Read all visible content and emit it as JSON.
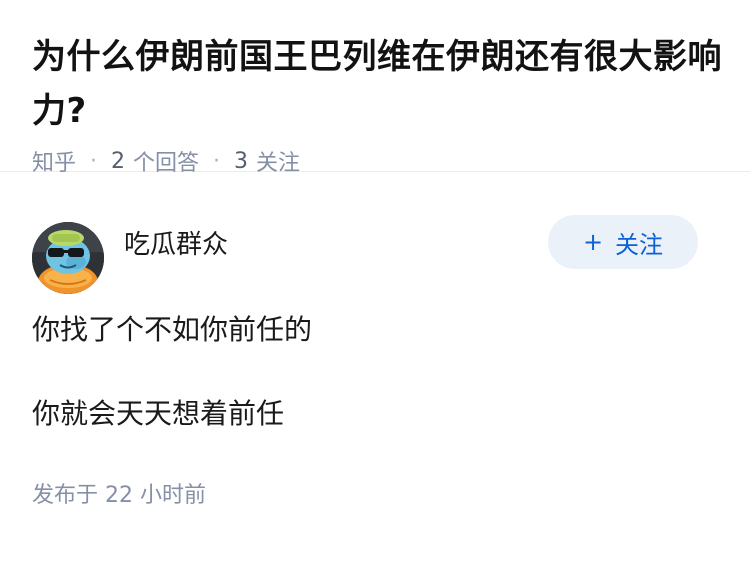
{
  "question": {
    "title": "为什么伊朗前国王巴列维在伊朗还有很大影响力?",
    "source": "知乎",
    "answer_count": "2",
    "answer_label": "个回答",
    "follow_count": "3",
    "follow_label": "关注"
  },
  "answer": {
    "author_name": "吃瓜群众",
    "avatar_icon": "cartoon-turtle-avatar",
    "follow_button": {
      "icon": "plus-icon",
      "icon_glyph": "+",
      "label": "关注"
    },
    "paragraphs": [
      "你找了个不如你前任的",
      "你就会天天想着前任"
    ],
    "publish_prefix": "发布于",
    "publish_number": "22",
    "publish_suffix": "小时前"
  },
  "colors": {
    "meta_gray": "#8590a6",
    "follow_blue": "#0b62d6",
    "follow_bg": "#ebf1f8"
  }
}
